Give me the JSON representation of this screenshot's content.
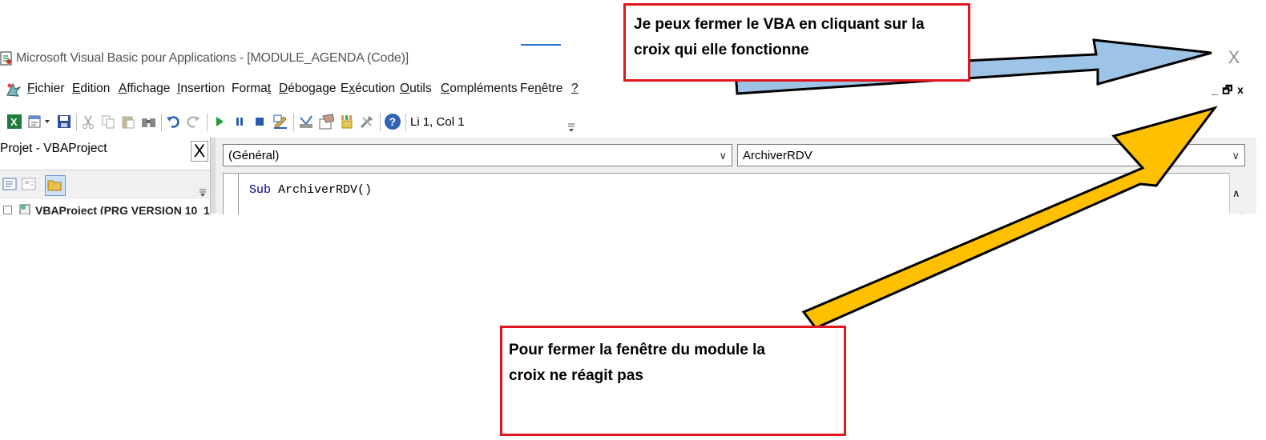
{
  "window": {
    "title": "Microsoft Visual Basic pour Applications - [MODULE_AGENDA (Code)]",
    "close_glyph": "X",
    "restore_glyph": "⧉"
  },
  "menu": {
    "items": [
      {
        "pre": "",
        "acc": "F",
        "post": "ichier"
      },
      {
        "pre": "",
        "acc": "E",
        "post": "dition"
      },
      {
        "pre": "",
        "acc": "A",
        "post": "ffichage"
      },
      {
        "pre": "",
        "acc": "I",
        "post": "nsertion"
      },
      {
        "pre": "Forma",
        "acc": "t",
        "post": ""
      },
      {
        "pre": "",
        "acc": "D",
        "post": "ébogage"
      },
      {
        "pre": "E",
        "acc": "x",
        "post": "écution"
      },
      {
        "pre": "",
        "acc": "O",
        "post": "utils"
      },
      {
        "pre": "",
        "acc": "C",
        "post": "ompléments"
      },
      {
        "pre": "Fe",
        "acc": "n",
        "post": "être"
      },
      {
        "pre": "",
        "acc": "?",
        "post": ""
      }
    ],
    "mdi": {
      "minimize": "_",
      "restore": "🗗",
      "close": "x"
    }
  },
  "toolbar": {
    "position": "Li 1, Col 1",
    "icons": [
      "excel-icon",
      "userform-icon",
      "save-icon",
      "cut-icon",
      "copy-icon",
      "paste-icon",
      "find-icon",
      "undo-icon",
      "redo-icon",
      "run-icon",
      "break-icon",
      "reset-icon",
      "design-mode-icon",
      "project-explorer-icon",
      "properties-icon",
      "object-browser-icon",
      "toolbox-icon",
      "help-icon"
    ]
  },
  "project": {
    "title": "Projet - VBAProject",
    "close": "X",
    "tree_item": "VBAProject (PRG VERSION 10_1"
  },
  "code": {
    "object_combo": "(Général)",
    "procedure_combo": "ArchiverRDV",
    "keyword": "Sub",
    "line_rest": " ArchiverRDV()"
  },
  "annotations": {
    "top_line1": "Je peux fermer le VBA en cliquant sur la",
    "top_line2": "croix qui elle fonctionne",
    "bottom_line1": "Pour fermer la fenêtre du module la",
    "bottom_line2": "croix ne réagit pas",
    "colors": {
      "box_border": "#e2171d",
      "arrow_blue": "#9dc3e6",
      "arrow_yellow": "#ffc000"
    }
  }
}
